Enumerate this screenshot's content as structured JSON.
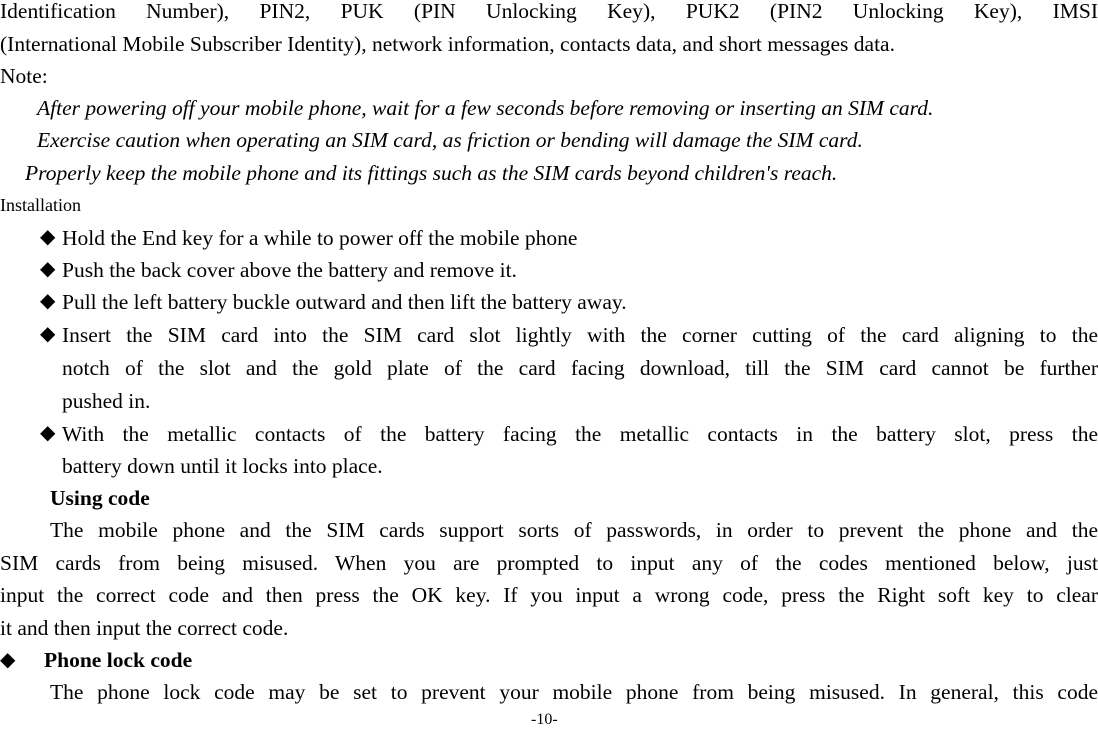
{
  "intro": {
    "line1": "Identification Number), PIN2, PUK (PIN Unlocking Key), PUK2 (PIN2 Unlocking Key), IMSI",
    "line2": "(International Mobile Subscriber Identity), network information, contacts data, and short messages data."
  },
  "note": {
    "label": "Note:",
    "items": [
      "After powering off your mobile phone, wait for a few seconds before removing or inserting an SIM card.",
      "Exercise caution when operating an SIM card, as friction or bending will damage the SIM card.",
      "Properly keep the mobile phone and its fittings such as the SIM cards beyond children's reach."
    ]
  },
  "installation": {
    "heading": "Installation",
    "bullet_glyph": "◆",
    "steps": [
      [
        "Hold the End key for a while to power off the mobile phone"
      ],
      [
        "Push the back cover above the battery and remove it."
      ],
      [
        "Pull the left battery buckle outward and then lift the battery away."
      ],
      [
        "Insert the SIM card into the SIM card slot lightly with the corner cutting of the card aligning to the",
        "notch of the slot and the gold plate of the card facing download, till the SIM card cannot be further",
        "pushed in."
      ],
      [
        "With the metallic contacts of the battery facing the metallic contacts in the battery slot, press the",
        "battery down until it locks into place."
      ]
    ]
  },
  "using_code": {
    "heading": "Using code",
    "paragraph": [
      "The mobile phone and the SIM cards support sorts of passwords, in order to prevent the phone and the",
      "SIM cards from being misused. When you are prompted to input any of the codes mentioned below, just",
      "input the correct code and then press the OK key. If you input a wrong code, press the Right soft key to clear",
      "it and then input the correct code."
    ]
  },
  "phone_lock": {
    "heading": "Phone lock code",
    "text": "The phone lock code may be set to prevent your mobile phone from being misused. In general, this code"
  },
  "page_number": "-10-"
}
